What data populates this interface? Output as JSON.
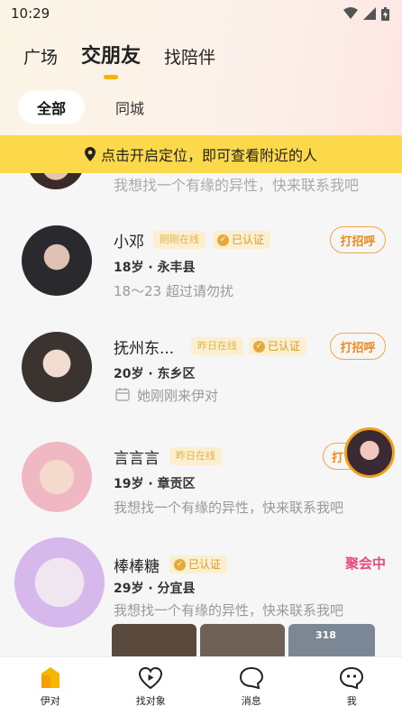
{
  "status_bar": {
    "time": "10:29"
  },
  "top_tabs": [
    {
      "label": "广场",
      "active": false
    },
    {
      "label": "交朋友",
      "active": true
    },
    {
      "label": "找陪伴",
      "active": false
    }
  ],
  "sub_tabs": [
    {
      "label": "全部",
      "active": true
    },
    {
      "label": "同城",
      "active": false
    }
  ],
  "location_banner": {
    "text": "点击开启定位，即可查看附近的人"
  },
  "partial_card": {
    "desc": "我想找一个有缘的异性，快来联系我吧"
  },
  "cards": [
    {
      "name": "小邓",
      "online": "刚刚在线",
      "verified": "已认证",
      "info": "18岁 · 永丰县",
      "desc": "18～23 超过请勿扰",
      "action": "打招呼"
    },
    {
      "name": "抚州东...",
      "online": "昨日在线",
      "verified": "已认证",
      "info": "20岁 · 东乡区",
      "desc": "她刚刚来伊对",
      "action": "打招呼"
    },
    {
      "name": "言言言",
      "online": "昨日在线",
      "info": "19岁 · 章贡区",
      "desc": "我想找一个有缘的异性，快来联系我吧",
      "action": "打"
    },
    {
      "name": "棒棒糖",
      "verified": "已认证",
      "live": "聚会中",
      "info": "29岁 · 分宜县",
      "desc": "我想找一个有缘的异性，快来联系我吧",
      "thumb_text": "318"
    }
  ],
  "bottom_nav": [
    {
      "label": "伊对",
      "icon": "home-icon",
      "active": true
    },
    {
      "label": "找对象",
      "icon": "heart-play-icon",
      "active": false
    },
    {
      "label": "消息",
      "icon": "chat-bubble-icon",
      "active": false
    },
    {
      "label": "我",
      "icon": "profile-face-icon",
      "active": false
    }
  ],
  "colors": {
    "accent": "#f7b500",
    "banner": "#fcd94a",
    "greet": "#ec8a1c",
    "live": "#e84a7f"
  }
}
